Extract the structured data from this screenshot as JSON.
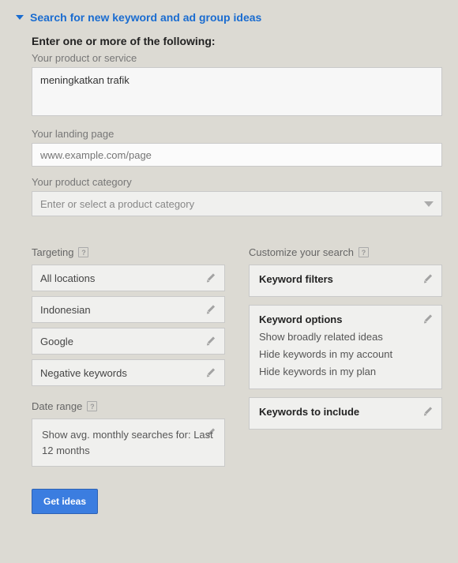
{
  "header": {
    "title": "Search for new keyword and ad group ideas"
  },
  "intro": {
    "heading": "Enter one or more of the following:",
    "product_label": "Your product or service",
    "product_value": "meningkatkan trafik",
    "landing_label": "Your landing page",
    "landing_placeholder": "www.example.com/page",
    "category_label": "Your product category",
    "category_placeholder": "Enter or select a product category"
  },
  "targeting": {
    "heading": "Targeting",
    "rows": [
      "All locations",
      "Indonesian",
      "Google",
      "Negative keywords"
    ]
  },
  "date_range": {
    "heading": "Date range",
    "text": "Show avg. monthly searches for: Last 12 months"
  },
  "customize": {
    "heading": "Customize your search",
    "filters_title": "Keyword filters",
    "options_title": "Keyword options",
    "options_lines": [
      "Show broadly related ideas",
      "Hide keywords in my account",
      "Hide keywords in my plan"
    ],
    "include_title": "Keywords to include"
  },
  "actions": {
    "get_ideas": "Get ideas"
  }
}
